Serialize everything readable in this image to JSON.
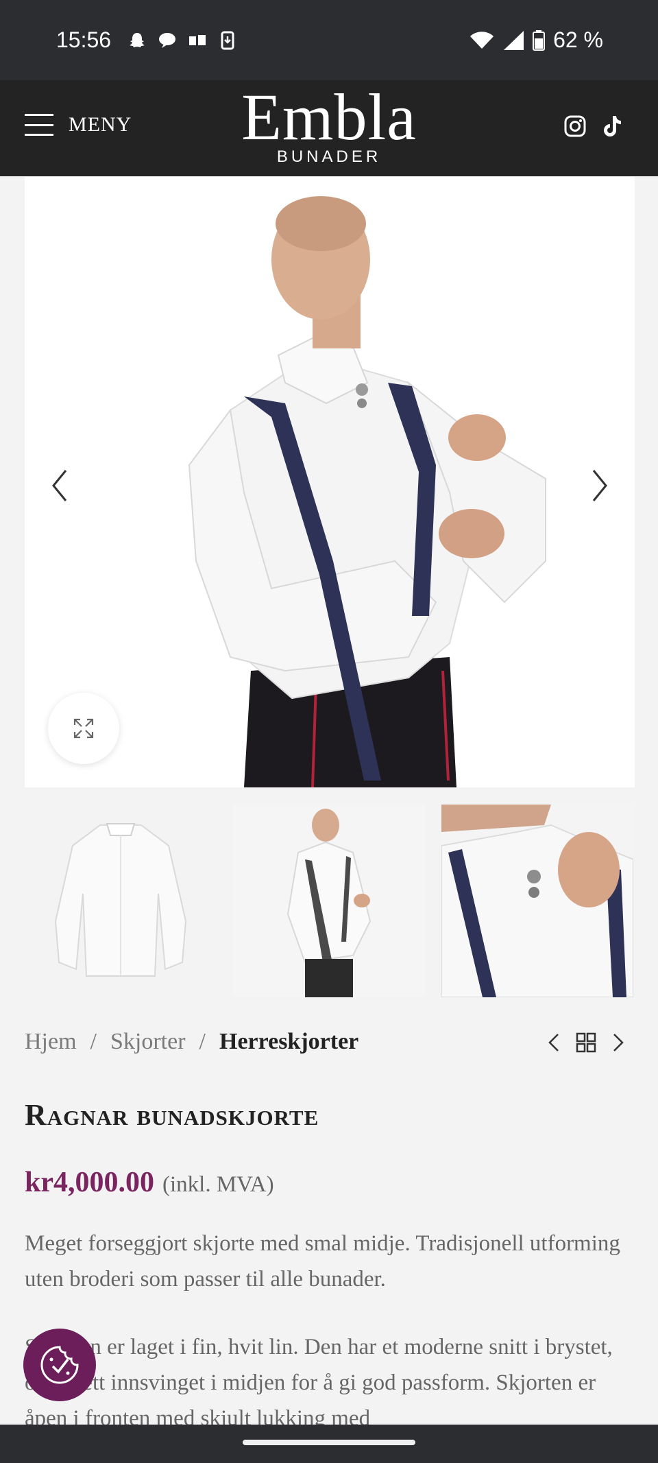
{
  "status_bar": {
    "time": "15:56",
    "battery": "62 %",
    "left_icons": [
      "snapchat-icon",
      "chat-icon",
      "app-icon",
      "download-icon"
    ],
    "right_icons": [
      "wifi-icon",
      "signal-icon",
      "battery-icon"
    ]
  },
  "header": {
    "menu_label": "MENY",
    "logo_main": "Embla",
    "logo_sub": "BUNADER",
    "social_icons": [
      "instagram-icon",
      "tiktok-icon"
    ]
  },
  "gallery": {
    "main_image": "product-photo-man-white-shirt-suspenders",
    "thumbnails": [
      "shirt-front-thumbnail",
      "man-wearing-shirt-thumbnail",
      "collar-detail-thumbnail"
    ]
  },
  "breadcrumb": {
    "home": "Hjem",
    "sep1": "/",
    "category": "Skjorter",
    "sep2": "/",
    "current": "Herreskjorter"
  },
  "product": {
    "title": "Ragnar bunadskjorte",
    "price": "kr4,000.00",
    "vat": "(inkl. MVA)",
    "description_1": "Meget forseggjort skjorte med smal midje. Tradisjonell utforming uten broderi som passer til alle bunader.",
    "description_2": "Skjorten er laget i fin, hvit lin. Den har et moderne snitt i brystet, og er lett innsvinget i midjen for å gi god passform. Skjorten er åpen i fronten med skjult lukking med"
  },
  "colors": {
    "header_bg": "#232323",
    "accent_price": "#7a2560",
    "cookie_bg": "#6b1e5a"
  }
}
